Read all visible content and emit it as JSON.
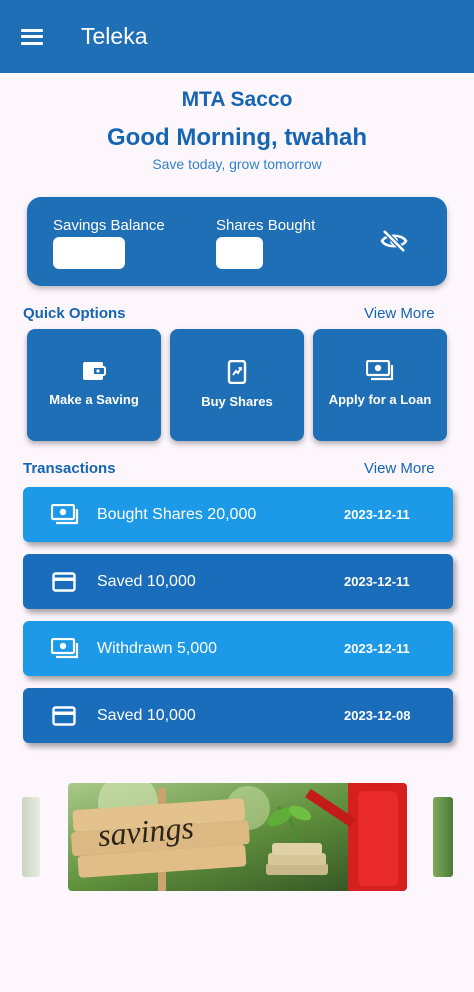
{
  "appbar": {
    "title": "Teleka"
  },
  "header": {
    "org_name": "MTA Sacco",
    "greeting": "Good Morning, twahah",
    "tagline": "Save today, grow tomorrow"
  },
  "balance": {
    "savings_label": "Savings Balance",
    "savings_value": "",
    "shares_label": "Shares Bought",
    "shares_value": "",
    "visibility_icon": "eye-off-icon"
  },
  "quick_options": {
    "title": "Quick Options",
    "view_more": "View More",
    "items": [
      {
        "label": "Make a Saving",
        "icon": "wallet-icon"
      },
      {
        "label": "Buy Shares",
        "icon": "phone-trend-icon"
      },
      {
        "label": "Apply for a Loan",
        "icon": "money-icon"
      }
    ]
  },
  "transactions": {
    "title": "Transactions",
    "view_more": "View More",
    "items": [
      {
        "description": "Bought Shares 20,000",
        "date": "2023-12-11",
        "icon": "money-icon"
      },
      {
        "description": "Saved 10,000",
        "date": "2023-12-11",
        "icon": "card-icon"
      },
      {
        "description": "Withdrawn 5,000",
        "date": "2023-12-11",
        "icon": "money-icon"
      },
      {
        "description": "Saved 10,000",
        "date": "2023-12-08",
        "icon": "card-icon"
      }
    ]
  },
  "carousel": {
    "banner_text": "savings"
  },
  "colors": {
    "primary": "#1f6fb7",
    "light_row": "#1c9ae8",
    "dark_row": "#1a6dbb",
    "text_blue": "#1565b3"
  }
}
